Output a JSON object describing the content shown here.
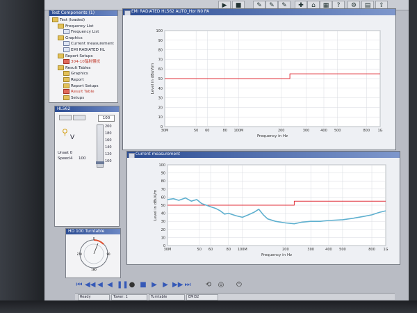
{
  "test_tree": {
    "title": "Test Components (1)",
    "items": [
      {
        "label": "Test (loaded)",
        "indent": 0,
        "icon": "folder-icon"
      },
      {
        "label": "Frequency List",
        "indent": 1,
        "icon": "folder-icon"
      },
      {
        "label": "Frequency List",
        "indent": 2,
        "icon": "doc-icon"
      },
      {
        "label": "Graphics",
        "indent": 1,
        "icon": "folder-icon"
      },
      {
        "label": "Current measurement",
        "indent": 2,
        "icon": "doc-icon"
      },
      {
        "label": "EMI RADIATED HL",
        "indent": 2,
        "icon": "doc-icon"
      },
      {
        "label": "Report Setups",
        "indent": 1,
        "icon": "folder-icon"
      },
      {
        "label": "304-10辐射骚扰",
        "indent": 2,
        "icon": "red-doc-icon",
        "highlight": true
      },
      {
        "label": "Result Tables",
        "indent": 1,
        "icon": "folder-icon"
      },
      {
        "label": "Graphics",
        "indent": 2,
        "icon": "folder-icon"
      },
      {
        "label": "Report",
        "indent": 2,
        "icon": "folder-icon"
      },
      {
        "label": "Report Setups",
        "indent": 2,
        "icon": "folder-icon"
      },
      {
        "label": "Result Table",
        "indent": 2,
        "icon": "red-doc-icon",
        "highlight": true
      },
      {
        "label": "Setups",
        "indent": 2,
        "icon": "folder-icon"
      }
    ]
  },
  "device_panel": {
    "title": "HL562",
    "value_box": "100",
    "unit": "V",
    "level_ticks": [
      "200",
      "180",
      "160",
      "140",
      "120",
      "100"
    ],
    "unset_label": "Unset 0",
    "speed_label": "Speed",
    "speed_value": "4",
    "speed_extra": "100"
  },
  "turntable_panel": {
    "title": "HD 100 Turntable",
    "dial_labels": [
      "0",
      "90",
      "180",
      "270"
    ]
  },
  "charts": [
    {
      "window_title": "EMI RADIATED HL562 AUTO_Hor N0 PA",
      "ylabel": "Level in dBuV/m",
      "xlabel": "Frequency in Hz",
      "chart_data": {
        "type": "line",
        "xscale": "log",
        "xlim": [
          30000000,
          1000000000
        ],
        "ylim": [
          0,
          100
        ],
        "yticks": [
          0,
          10,
          20,
          30,
          40,
          50,
          60,
          70,
          80,
          90,
          100
        ],
        "xticks": [
          {
            "value": 30000000,
            "label": "30M"
          },
          {
            "value": 50000000,
            "label": "50"
          },
          {
            "value": 60000000,
            "label": "60"
          },
          {
            "value": 80000000,
            "label": "80"
          },
          {
            "value": 100000000,
            "label": "100M"
          },
          {
            "value": 200000000,
            "label": "200"
          },
          {
            "value": 300000000,
            "label": "300"
          },
          {
            "value": 400000000,
            "label": "400"
          },
          {
            "value": 500000000,
            "label": "500"
          },
          {
            "value": 800000000,
            "label": "800"
          },
          {
            "value": 1000000000,
            "label": "1G"
          }
        ],
        "series": [
          {
            "color": "#e0303a",
            "x": [
              30000000,
              230000000,
              230000000,
              1000000000
            ],
            "y": [
              50,
              50,
              55,
              55
            ]
          }
        ]
      }
    },
    {
      "window_title": "Current measurement",
      "ylabel": "Level in dBuV/m",
      "xlabel": "Frequency in Hz",
      "chart_data": {
        "type": "line",
        "xscale": "log",
        "xlim": [
          30000000,
          1000000000
        ],
        "ylim": [
          0,
          100
        ],
        "yticks": [
          0,
          10,
          20,
          30,
          40,
          50,
          60,
          70,
          80,
          90,
          100
        ],
        "xticks": [
          {
            "value": 30000000,
            "label": "30M"
          },
          {
            "value": 50000000,
            "label": "50"
          },
          {
            "value": 60000000,
            "label": "60"
          },
          {
            "value": 80000000,
            "label": "80"
          },
          {
            "value": 100000000,
            "label": "100M"
          },
          {
            "value": 200000000,
            "label": "200"
          },
          {
            "value": 300000000,
            "label": "300"
          },
          {
            "value": 400000000,
            "label": "400"
          },
          {
            "value": 500000000,
            "label": "500"
          },
          {
            "value": 800000000,
            "label": "800"
          },
          {
            "value": 1000000000,
            "label": "1G"
          }
        ],
        "series": [
          {
            "color": "#e0303a",
            "x": [
              30000000,
              230000000,
              230000000,
              1000000000
            ],
            "y": [
              50,
              50,
              55,
              55
            ]
          },
          {
            "color": "#5fb0cf",
            "x": [
              30000000,
              33000000,
              36000000,
              40000000,
              44000000,
              48000000,
              52000000,
              56000000,
              60000000,
              65000000,
              70000000,
              75000000,
              80000000,
              90000000,
              100000000,
              110000000,
              120000000,
              130000000,
              140000000,
              150000000,
              170000000,
              200000000,
              230000000,
              260000000,
              300000000,
              350000000,
              400000000,
              500000000,
              600000000,
              700000000,
              800000000,
              900000000,
              1000000000
            ],
            "y": [
              57,
              58,
              56,
              59,
              55,
              57,
              52,
              50,
              48,
              46,
              43,
              39,
              40,
              37,
              35,
              38,
              41,
              45,
              38,
              33,
              30,
              28,
              27,
              29,
              30,
              30,
              31,
              32,
              34,
              36,
              38,
              41,
              43
            ]
          }
        ]
      }
    }
  ],
  "status": {
    "cells": [
      "Ready",
      "Tower: 1",
      "Turntable",
      "EMI32"
    ]
  }
}
